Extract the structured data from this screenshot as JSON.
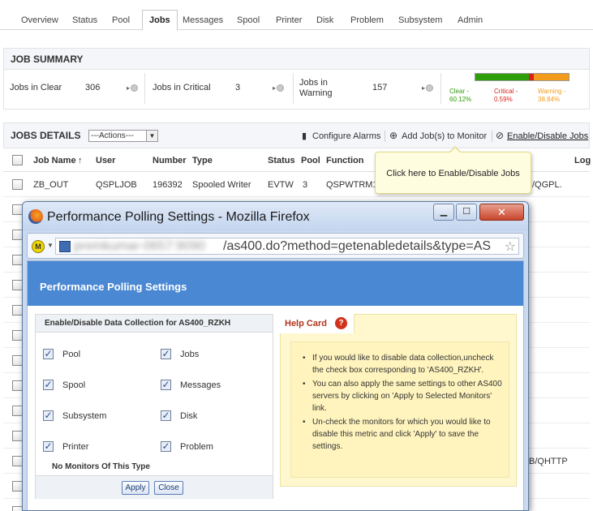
{
  "tabs": [
    "Overview",
    "Status",
    "Pool",
    "Jobs",
    "Messages",
    "Spool",
    "Printer",
    "Disk",
    "Problem",
    "Subsystem",
    "Admin"
  ],
  "active_tab": "Jobs",
  "summary": {
    "title": "JOB SUMMARY",
    "clear_label": "Jobs in Clear",
    "clear_count": "306",
    "critical_label": "Jobs in Critical",
    "critical_count": "3",
    "warning_label": "Jobs in Warning",
    "warning_count": "157",
    "bar": {
      "clear_label": "Clear -",
      "clear_pct": "60.12%",
      "clear_fraction": 0.6012,
      "critical_label": "Critical -",
      "critical_pct": "0.59%",
      "critical_fraction": 0.0059,
      "warning_label": "Warning -",
      "warning_pct": "38.84%",
      "warning_fraction": 0.3884
    },
    "colors": {
      "clear": "#2e9e0a",
      "critical": "#d9221c",
      "warning": "#f39c1c"
    }
  },
  "details": {
    "title": "JOBS DETAILS",
    "actions_label": "---Actions---",
    "configure_alarms": "Configure Alarms",
    "add_jobs": "Add Job(s) to Monitor",
    "enable_disable": "Enable/Disable Jobs",
    "columns": {
      "job_name": "Job Name",
      "sort_arrow": "↑",
      "user": "User",
      "number": "Number",
      "type": "Type",
      "status": "Status",
      "pool": "Pool",
      "function": "Function",
      "log": "Log"
    },
    "first_row": {
      "job_name": "ZB_OUT",
      "user": "QSPLJOB",
      "number": "196392",
      "type": "Spooled Writer",
      "status": "EVTW",
      "pool": "3",
      "function": "QSPWTRM1",
      "log_tail": "/QGPL."
    },
    "row_fragment": "B/QHTTP"
  },
  "tooltip": {
    "text": "Click here to Enable/Disable Jobs"
  },
  "popup": {
    "window_title": "Performance Polling Settings - Mozilla Firefox",
    "url_host": "premkumar-0657:9090",
    "url_path": "/as400.do?method=getenabledetails&type=AS",
    "header": "Performance Polling Settings",
    "panel_title": "Enable/Disable Data Collection for AS400_RZKH",
    "checkboxes": [
      {
        "label": "Pool",
        "checked": true
      },
      {
        "label": "Jobs",
        "checked": true
      },
      {
        "label": "Spool",
        "checked": true
      },
      {
        "label": "Messages",
        "checked": true
      },
      {
        "label": "Subsystem",
        "checked": true
      },
      {
        "label": "Disk",
        "checked": true
      },
      {
        "label": "Printer",
        "checked": true
      },
      {
        "label": "Problem",
        "checked": true
      }
    ],
    "no_monitors": "No Monitors Of This Type",
    "apply": "Apply",
    "close": "Close",
    "help_title": "Help Card",
    "help_items": [
      "If you would like to disable data collection,uncheck the check box corresponding to 'AS400_RZKH'.",
      "You can also apply the same settings to other AS400 servers by clicking on 'Apply to Selected Monitors' link.",
      "Un-check the monitors for which you would like to disable this metric and click 'Apply' to save the settings."
    ]
  }
}
